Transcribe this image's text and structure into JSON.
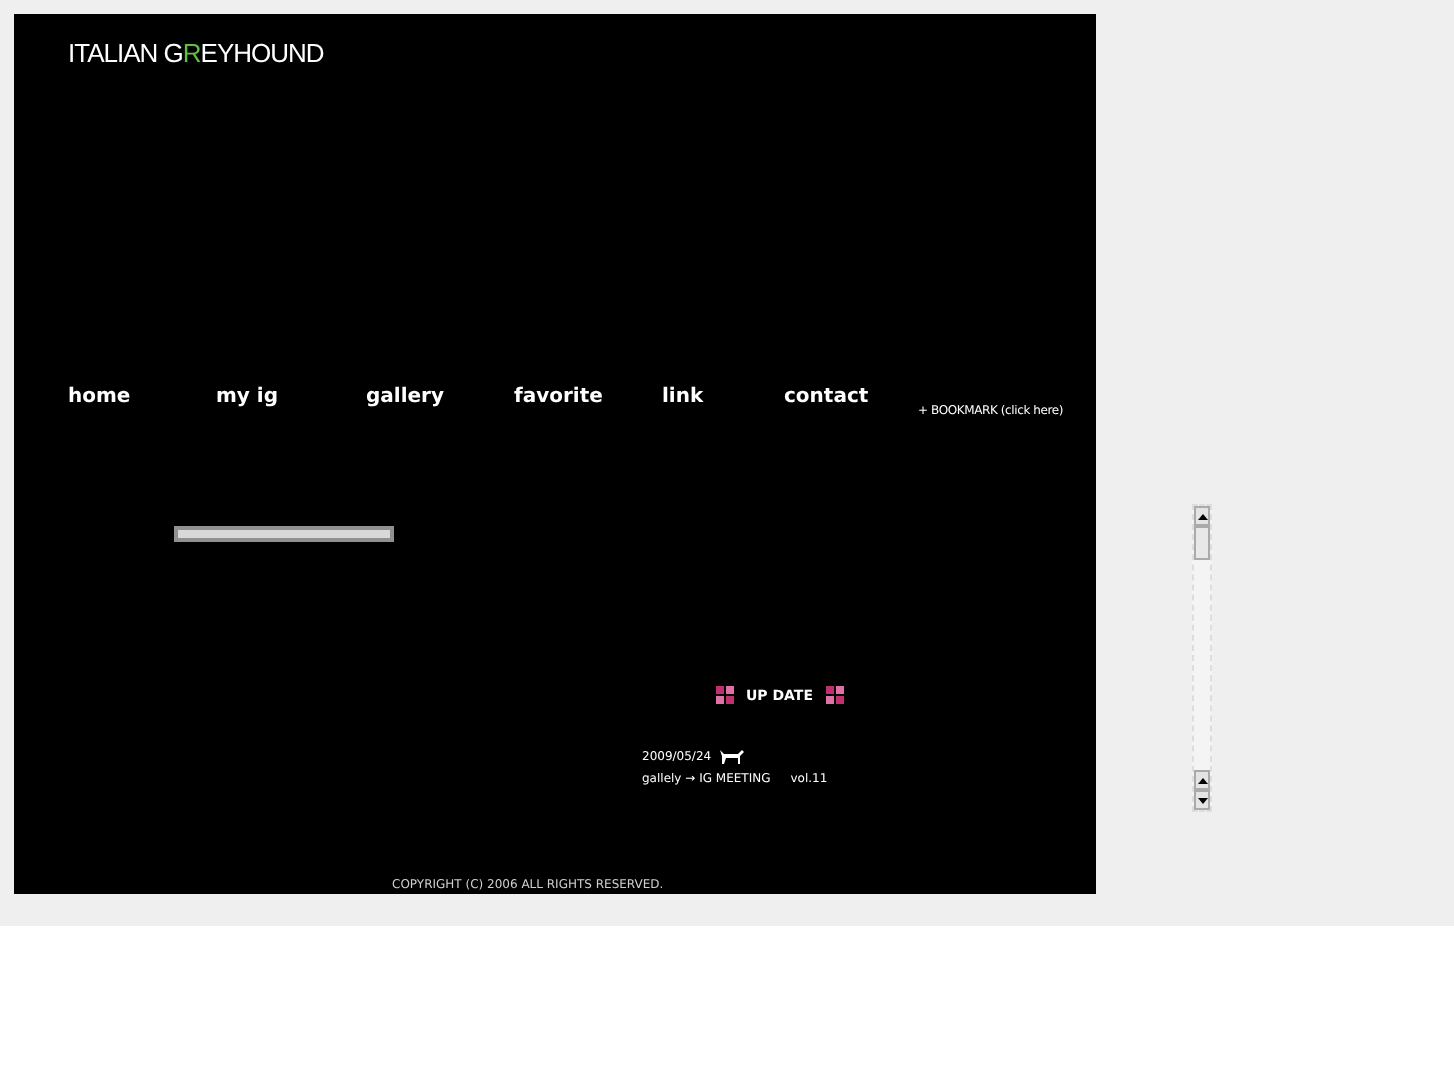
{
  "logo": {
    "before": "ITALIAN G",
    "highlight": "R",
    "after": "EYHOUND"
  },
  "nav": [
    {
      "label": "home"
    },
    {
      "label": "my ig"
    },
    {
      "label": "gallery"
    },
    {
      "label": "favorite"
    },
    {
      "label": "link"
    },
    {
      "label": "contact"
    }
  ],
  "bookmark": "+ BOOKMARK (click here)",
  "update": {
    "title": "UP DATE",
    "date": "2009/05/24",
    "entry": "gallely → IG MEETING",
    "volume": "vol.11"
  },
  "copyright": "COPYRIGHT (C) 2006 ALL RIGHTS RESERVED."
}
